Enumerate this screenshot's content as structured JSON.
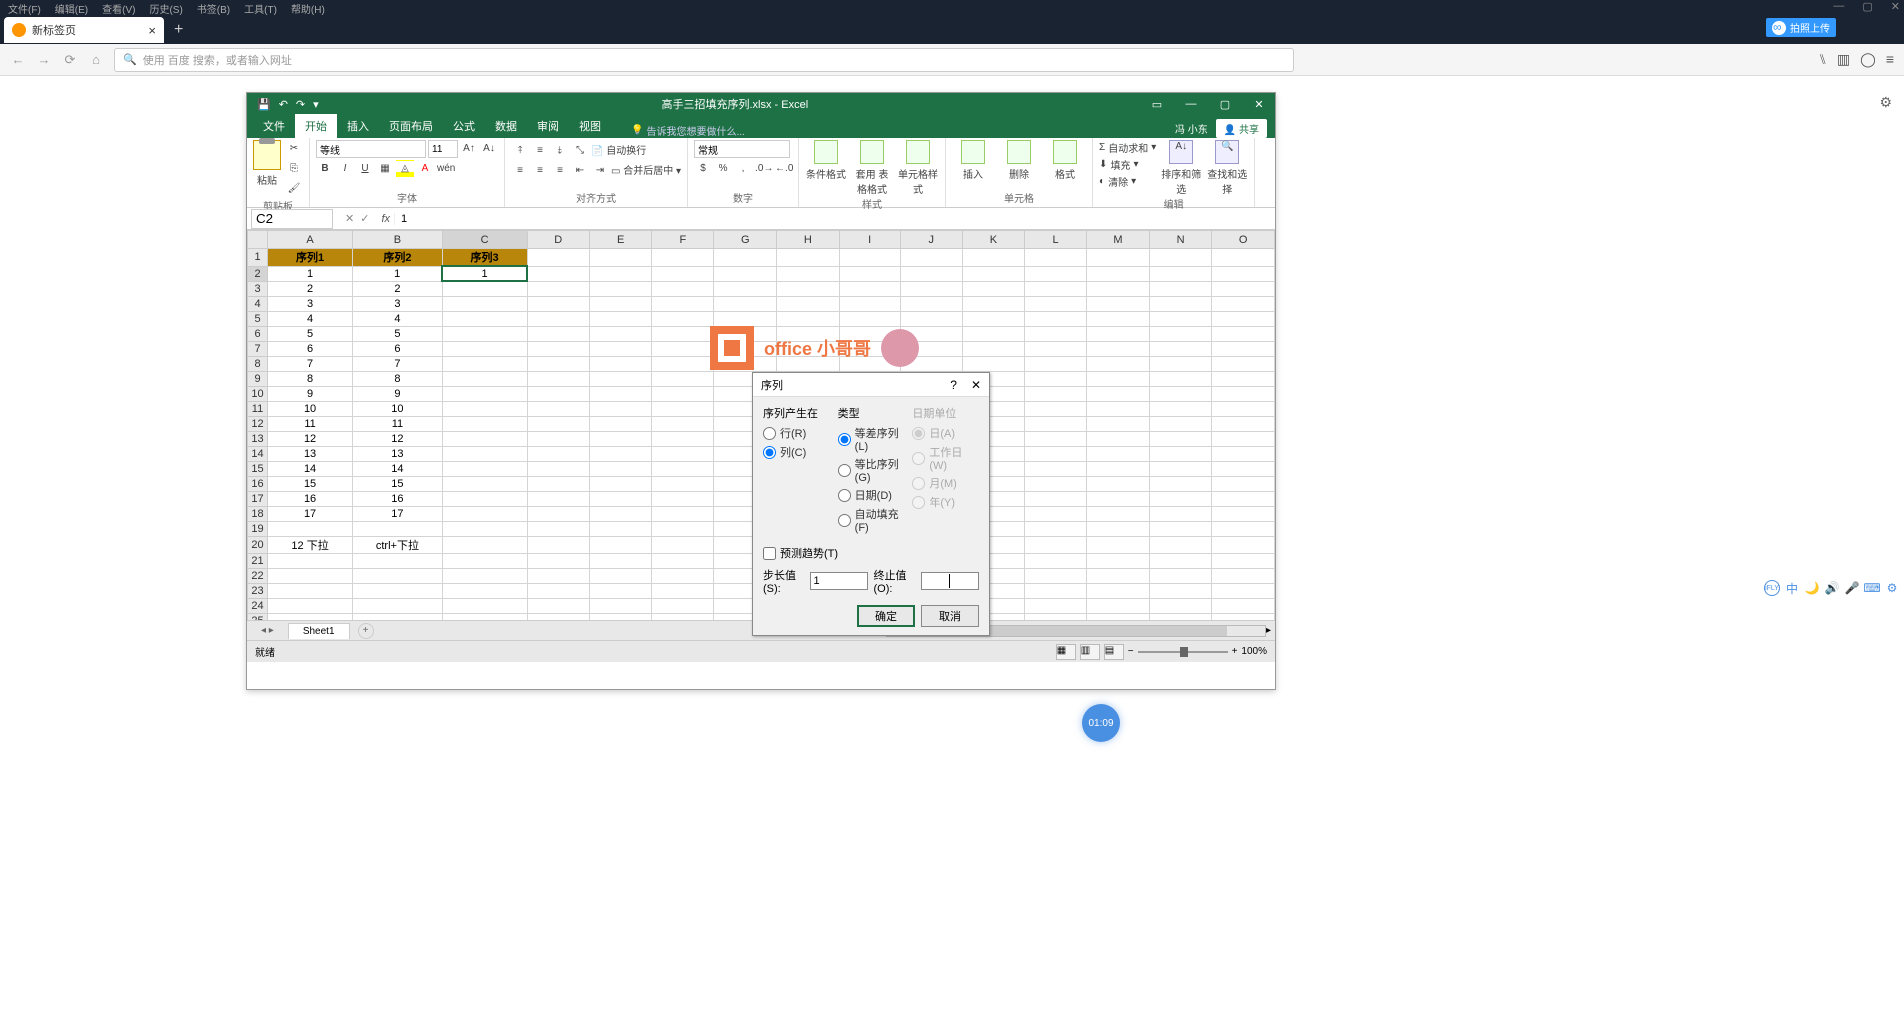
{
  "outer_menu": [
    "文件(F)",
    "编辑(E)",
    "查看(V)",
    "历史(S)",
    "书签(B)",
    "工具(T)",
    "帮助(H)"
  ],
  "browser_tab": {
    "title": "新标签页"
  },
  "url_placeholder": "使用 百度 搜索，或者输入网址",
  "upload": "拍照上传",
  "excel": {
    "title": "高手三招填充序列.xlsx - Excel",
    "user": "冯 小东",
    "share": "共享",
    "tabs": [
      "文件",
      "开始",
      "插入",
      "页面布局",
      "公式",
      "数据",
      "审阅",
      "视图"
    ],
    "tell_me": "告诉我您想要做什么...",
    "groups": {
      "clipboard": "剪贴板",
      "paste": "粘贴",
      "font": "字体",
      "font_name": "等线",
      "font_size": "11",
      "alignment": "对齐方式",
      "wrap": "自动换行",
      "merge": "合并后居中",
      "number": "数字",
      "number_fmt": "常规",
      "styles": "样式",
      "cond_fmt": "条件格式",
      "table_fmt": "套用\n表格格式",
      "cell_styles": "单元格样式",
      "cells": "单元格",
      "insert": "插入",
      "delete": "删除",
      "format": "格式",
      "editing": "编辑",
      "autosum": "自动求和",
      "fill": "填充",
      "clear": "清除",
      "sort": "排序和筛选",
      "find": "查找和选择"
    },
    "name_box": "C2",
    "formula_value": "1"
  },
  "columns": [
    "A",
    "B",
    "C",
    "D",
    "E",
    "F",
    "G",
    "H",
    "I",
    "J",
    "K",
    "L",
    "M",
    "N",
    "O"
  ],
  "headers": [
    "序列1",
    "序列2",
    "序列3"
  ],
  "col_a": [
    "1",
    "2",
    "3",
    "4",
    "5",
    "6",
    "7",
    "8",
    "9",
    "10",
    "11",
    "12",
    "13",
    "14",
    "15",
    "16",
    "17"
  ],
  "col_b": [
    "1",
    "2",
    "3",
    "4",
    "5",
    "6",
    "7",
    "8",
    "9",
    "10",
    "11",
    "12",
    "13",
    "14",
    "15",
    "16",
    "17"
  ],
  "col_c_first": "1",
  "row20_a": "12 下拉",
  "row20_b": "ctrl+下拉",
  "sheet_name": "Sheet1",
  "status": "就绪",
  "zoom": "100%",
  "watermark": "office 小哥哥",
  "dialog": {
    "title": "序列",
    "group1_title": "序列产生在",
    "g1_opt1": "行(R)",
    "g1_opt2": "列(C)",
    "group2_title": "类型",
    "g2_opt1": "等差序列(L)",
    "g2_opt2": "等比序列(G)",
    "g2_opt3": "日期(D)",
    "g2_opt4": "自动填充(F)",
    "group3_title": "日期单位",
    "g3_opt1": "日(A)",
    "g3_opt2": "工作日(W)",
    "g3_opt3": "月(M)",
    "g3_opt4": "年(Y)",
    "trend": "预测趋势(T)",
    "step_label": "步长值(S):",
    "step_value": "1",
    "stop_label": "终止值(O):",
    "stop_value": "",
    "ok": "确定",
    "cancel": "取消"
  },
  "vid_time": "01:09"
}
